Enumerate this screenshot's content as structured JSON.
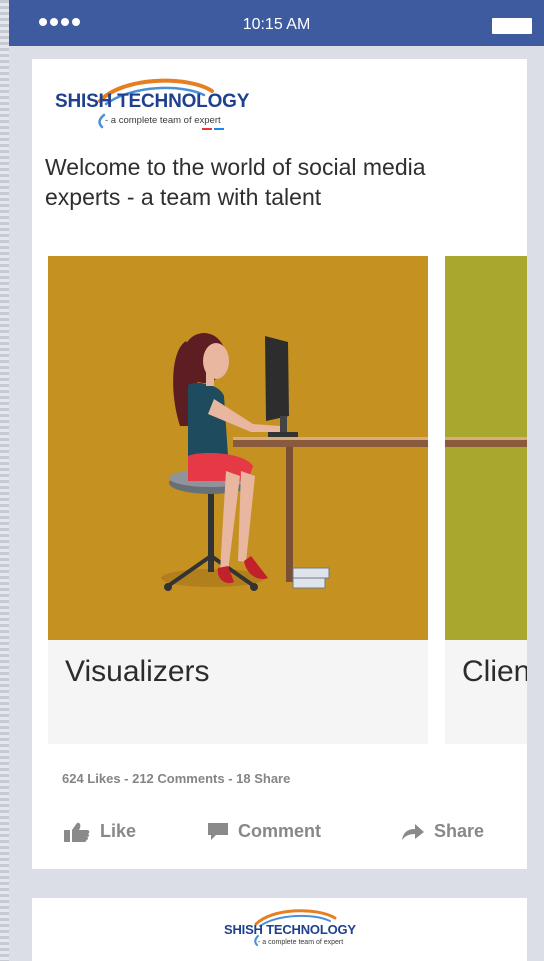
{
  "status_bar": {
    "time": "10:15 AM"
  },
  "post": {
    "brand": "SHISH TECHNOLOGY",
    "tagline": "- a complete team of expert",
    "text": "Welcome to the world of social media experts - a team with talent",
    "slides": [
      {
        "caption": "Visualizers",
        "bg_color": "#c59222"
      },
      {
        "caption": "Client",
        "bg_color": "#a9a72e"
      }
    ],
    "stats": "624 Likes  -  212 Comments  - 18 Share",
    "actions": {
      "like": "Like",
      "comment": "Comment",
      "share": "Share"
    }
  },
  "next_post": {
    "brand": "SHISH TECHNOLOGY",
    "tagline": "- a complete team of expert"
  }
}
